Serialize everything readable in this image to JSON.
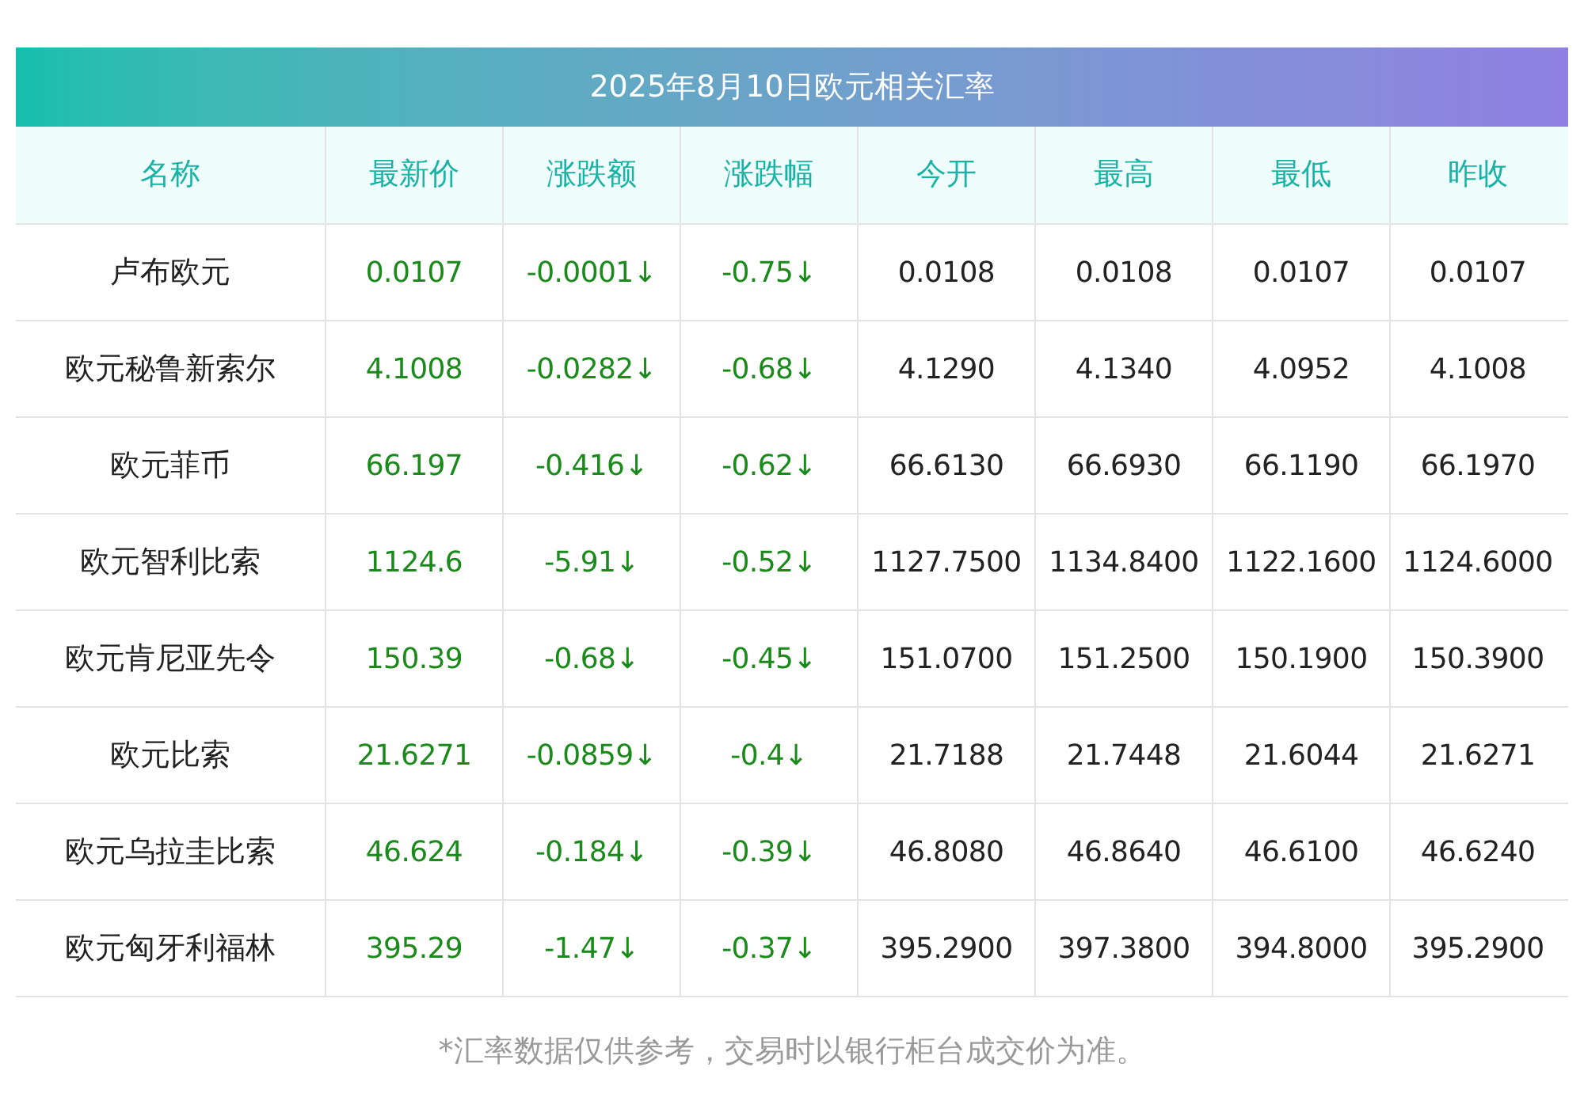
{
  "title": "2025年8月10日欧元相关汇率",
  "columns": [
    "名称",
    "最新价",
    "涨跌额",
    "涨跌幅",
    "今开",
    "最高",
    "最低",
    "昨收"
  ],
  "rows": [
    {
      "falling": true,
      "cells": [
        "卢布欧元",
        "0.0107",
        "-0.0001↓",
        "-0.75↓",
        "0.0108",
        "0.0108",
        "0.0107",
        "0.0107"
      ]
    },
    {
      "falling": true,
      "cells": [
        "欧元秘鲁新索尔",
        "4.1008",
        "-0.0282↓",
        "-0.68↓",
        "4.1290",
        "4.1340",
        "4.0952",
        "4.1008"
      ]
    },
    {
      "falling": true,
      "cells": [
        "欧元菲币",
        "66.197",
        "-0.416↓",
        "-0.62↓",
        "66.6130",
        "66.6930",
        "66.1190",
        "66.1970"
      ]
    },
    {
      "falling": true,
      "cells": [
        "欧元智利比索",
        "1124.6",
        "-5.91↓",
        "-0.52↓",
        "1127.7500",
        "1134.8400",
        "1122.1600",
        "1124.6000"
      ]
    },
    {
      "falling": true,
      "cells": [
        "欧元肯尼亚先令",
        "150.39",
        "-0.68↓",
        "-0.45↓",
        "151.0700",
        "151.2500",
        "150.1900",
        "150.3900"
      ]
    },
    {
      "falling": true,
      "cells": [
        "欧元比索",
        "21.6271",
        "-0.0859↓",
        "-0.4↓",
        "21.7188",
        "21.7448",
        "21.6044",
        "21.6271"
      ]
    },
    {
      "falling": true,
      "cells": [
        "欧元乌拉圭比索",
        "46.624",
        "-0.184↓",
        "-0.39↓",
        "46.8080",
        "46.8640",
        "46.6100",
        "46.6240"
      ]
    },
    {
      "falling": true,
      "cells": [
        "欧元匈牙利福林",
        "395.29",
        "-1.47↓",
        "-0.37↓",
        "395.2900",
        "397.3800",
        "394.8000",
        "395.2900"
      ]
    }
  ],
  "note": "*汇率数据仅供参考，交易时以银行柜台成交价为准。"
}
